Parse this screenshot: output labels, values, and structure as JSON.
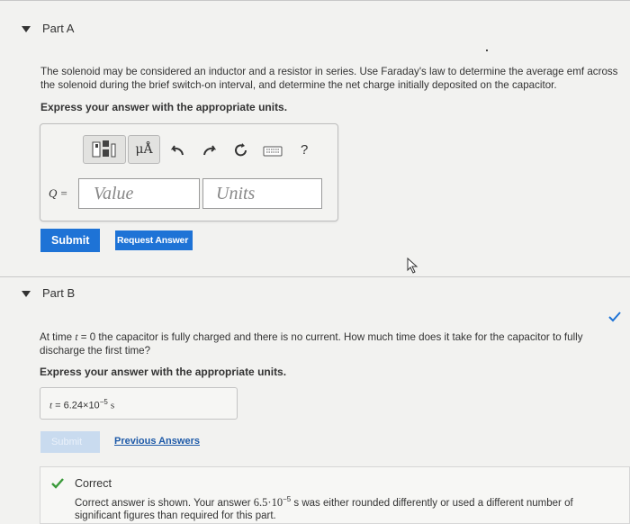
{
  "part_a": {
    "title": "Part A",
    "description": "The solenoid may be considered an inductor and a resistor in series. Use Faraday's law to determine the average emf across the solenoid during the brief switch-on interval, and determine the net charge initially deposited on the capacitor.",
    "instruction": "Express your answer with the appropriate units.",
    "toolbar": {
      "units_label": "μÅ",
      "help_label": "?"
    },
    "variable_label": "Q =",
    "value_placeholder": "Value",
    "units_placeholder": "Units",
    "submit_label": "Submit",
    "request_answer_label": "Request Answer"
  },
  "part_b": {
    "title": "Part B",
    "description_prefix": "At time ",
    "description_var": "t",
    "description_rest": " = 0 the capacitor is fully charged and there is no current. How much time does it take for the capacitor to fully discharge the first time?",
    "instruction": "Express your answer with the appropriate units.",
    "answer_var": "t",
    "answer_eq": " = ",
    "answer_mantissa": "6.24×10",
    "answer_exp": "−5",
    "answer_unit": "s",
    "submit_label": "Submit",
    "previous_answers_label": "Previous Answers"
  },
  "feedback": {
    "title": "Correct",
    "text_prefix": "Correct answer is shown. Your answer ",
    "text_value": "6.5·10",
    "text_exp": "−5",
    "text_suffix": " s was either rounded differently or used a different number of significant figures than required for this part."
  },
  "colors": {
    "accent_blue": "#1e73d6",
    "link_blue": "#1e5aa8",
    "correct_green": "#3a9a3a",
    "background": "#f2f2f0"
  }
}
